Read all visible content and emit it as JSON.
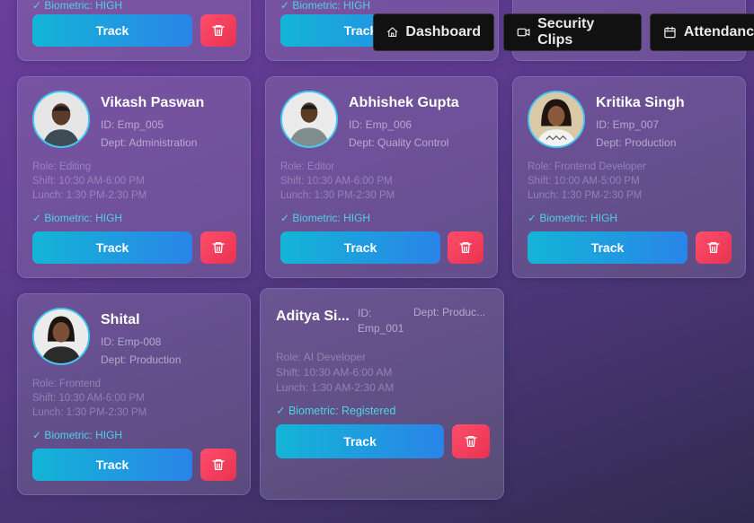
{
  "nav": {
    "dashboard": "Dashboard",
    "security_clips": "Security Clips",
    "attendance": "Attendance"
  },
  "top_row": {
    "biometric": "✓ Biometric: HIGH",
    "track": "Track"
  },
  "employees": [
    {
      "name": "Vikash Paswan",
      "id": "ID: Emp_005",
      "dept": "Dept: Administration",
      "role": "Role: Editing",
      "shift": "Shift: 10:30 AM-6:00 PM",
      "lunch": "Lunch: 1:30 PM-2:30 PM",
      "biometric": "✓ Biometric: HIGH",
      "track": "Track"
    },
    {
      "name": "Abhishek Gupta",
      "id": "ID: Emp_006",
      "dept": "Dept: Quality Control",
      "role": "Role: Editor",
      "shift": "Shift: 10:30 AM-6:00 PM",
      "lunch": "Lunch: 1:30 PM-2:30 PM",
      "biometric": "✓ Biometric: HIGH",
      "track": "Track"
    },
    {
      "name": "Kritika Singh",
      "id": "ID: Emp_007",
      "dept": "Dept: Production",
      "role": "Role: Frontend Developer",
      "shift": "Shift: 10:00 AM-5:00 PM",
      "lunch": "Lunch: 1:30 PM-2:30 PM",
      "biometric": "✓ Biometric: HIGH",
      "track": "Track"
    },
    {
      "name": "Shital",
      "id": "ID: Emp-008",
      "dept": "Dept: Production",
      "role": "Role: Frontend",
      "shift": "Shift: 10:30 AM-6:00 PM",
      "lunch": "Lunch: 1:30 PM-2:30 PM",
      "biometric": "✓ Biometric: HIGH",
      "track": "Track"
    },
    {
      "name": "Aditya Si...",
      "id_line1": "ID:",
      "id_line2": "Emp_001",
      "dept": "Dept: Produc...",
      "role": "Role: AI Developer",
      "shift": "Shift: 10:30 AM-6:00 AM",
      "lunch": "Lunch: 1:30 AM-2:30 AM",
      "biometric": "✓ Biometric: Registered",
      "track": "Track"
    }
  ],
  "colors": {
    "accent_cyan": "#13b5d6",
    "accent_blue": "#2a84e8",
    "danger": "#ff4d6d",
    "biometric_text": "#4fd1e6"
  }
}
